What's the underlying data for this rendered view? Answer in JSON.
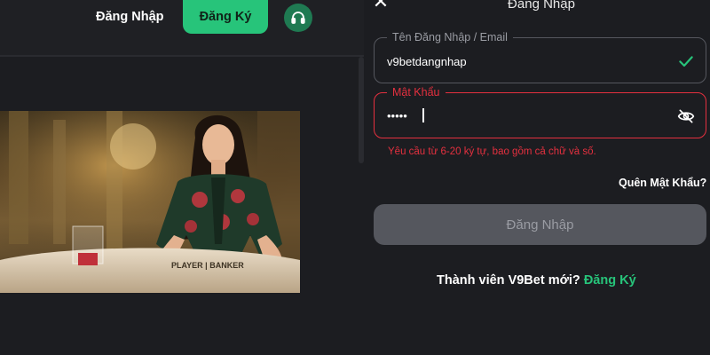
{
  "header": {
    "login_label": "Đăng Nhập",
    "register_label": "Đăng Ký",
    "support_icon": "headset-icon"
  },
  "banner": {
    "table_text": "PLAYER | BANKER"
  },
  "login_panel": {
    "title": "Đăng Nhập",
    "close_icon": "close-icon",
    "username": {
      "label": "Tên Đăng Nhập / Email",
      "value": "v9betdangnhap",
      "status_icon": "check-icon"
    },
    "password": {
      "label": "Mật Khẩu",
      "masked_value": "•••••",
      "toggle_icon": "eye-slash-icon",
      "error": "Yêu cầu từ 6-20 ký tự, bao gồm cả chữ và số."
    },
    "forgot_password": "Quên Mật Khẩu?",
    "submit_label": "Đăng Nhập",
    "signup_prompt": "Thành viên V9Bet mới?",
    "signup_link": "Đăng Ký"
  },
  "colors": {
    "accent_green": "#27c47a",
    "error_red": "#e5303f",
    "background": "#1c1d21",
    "disabled_button": "#55575e"
  }
}
